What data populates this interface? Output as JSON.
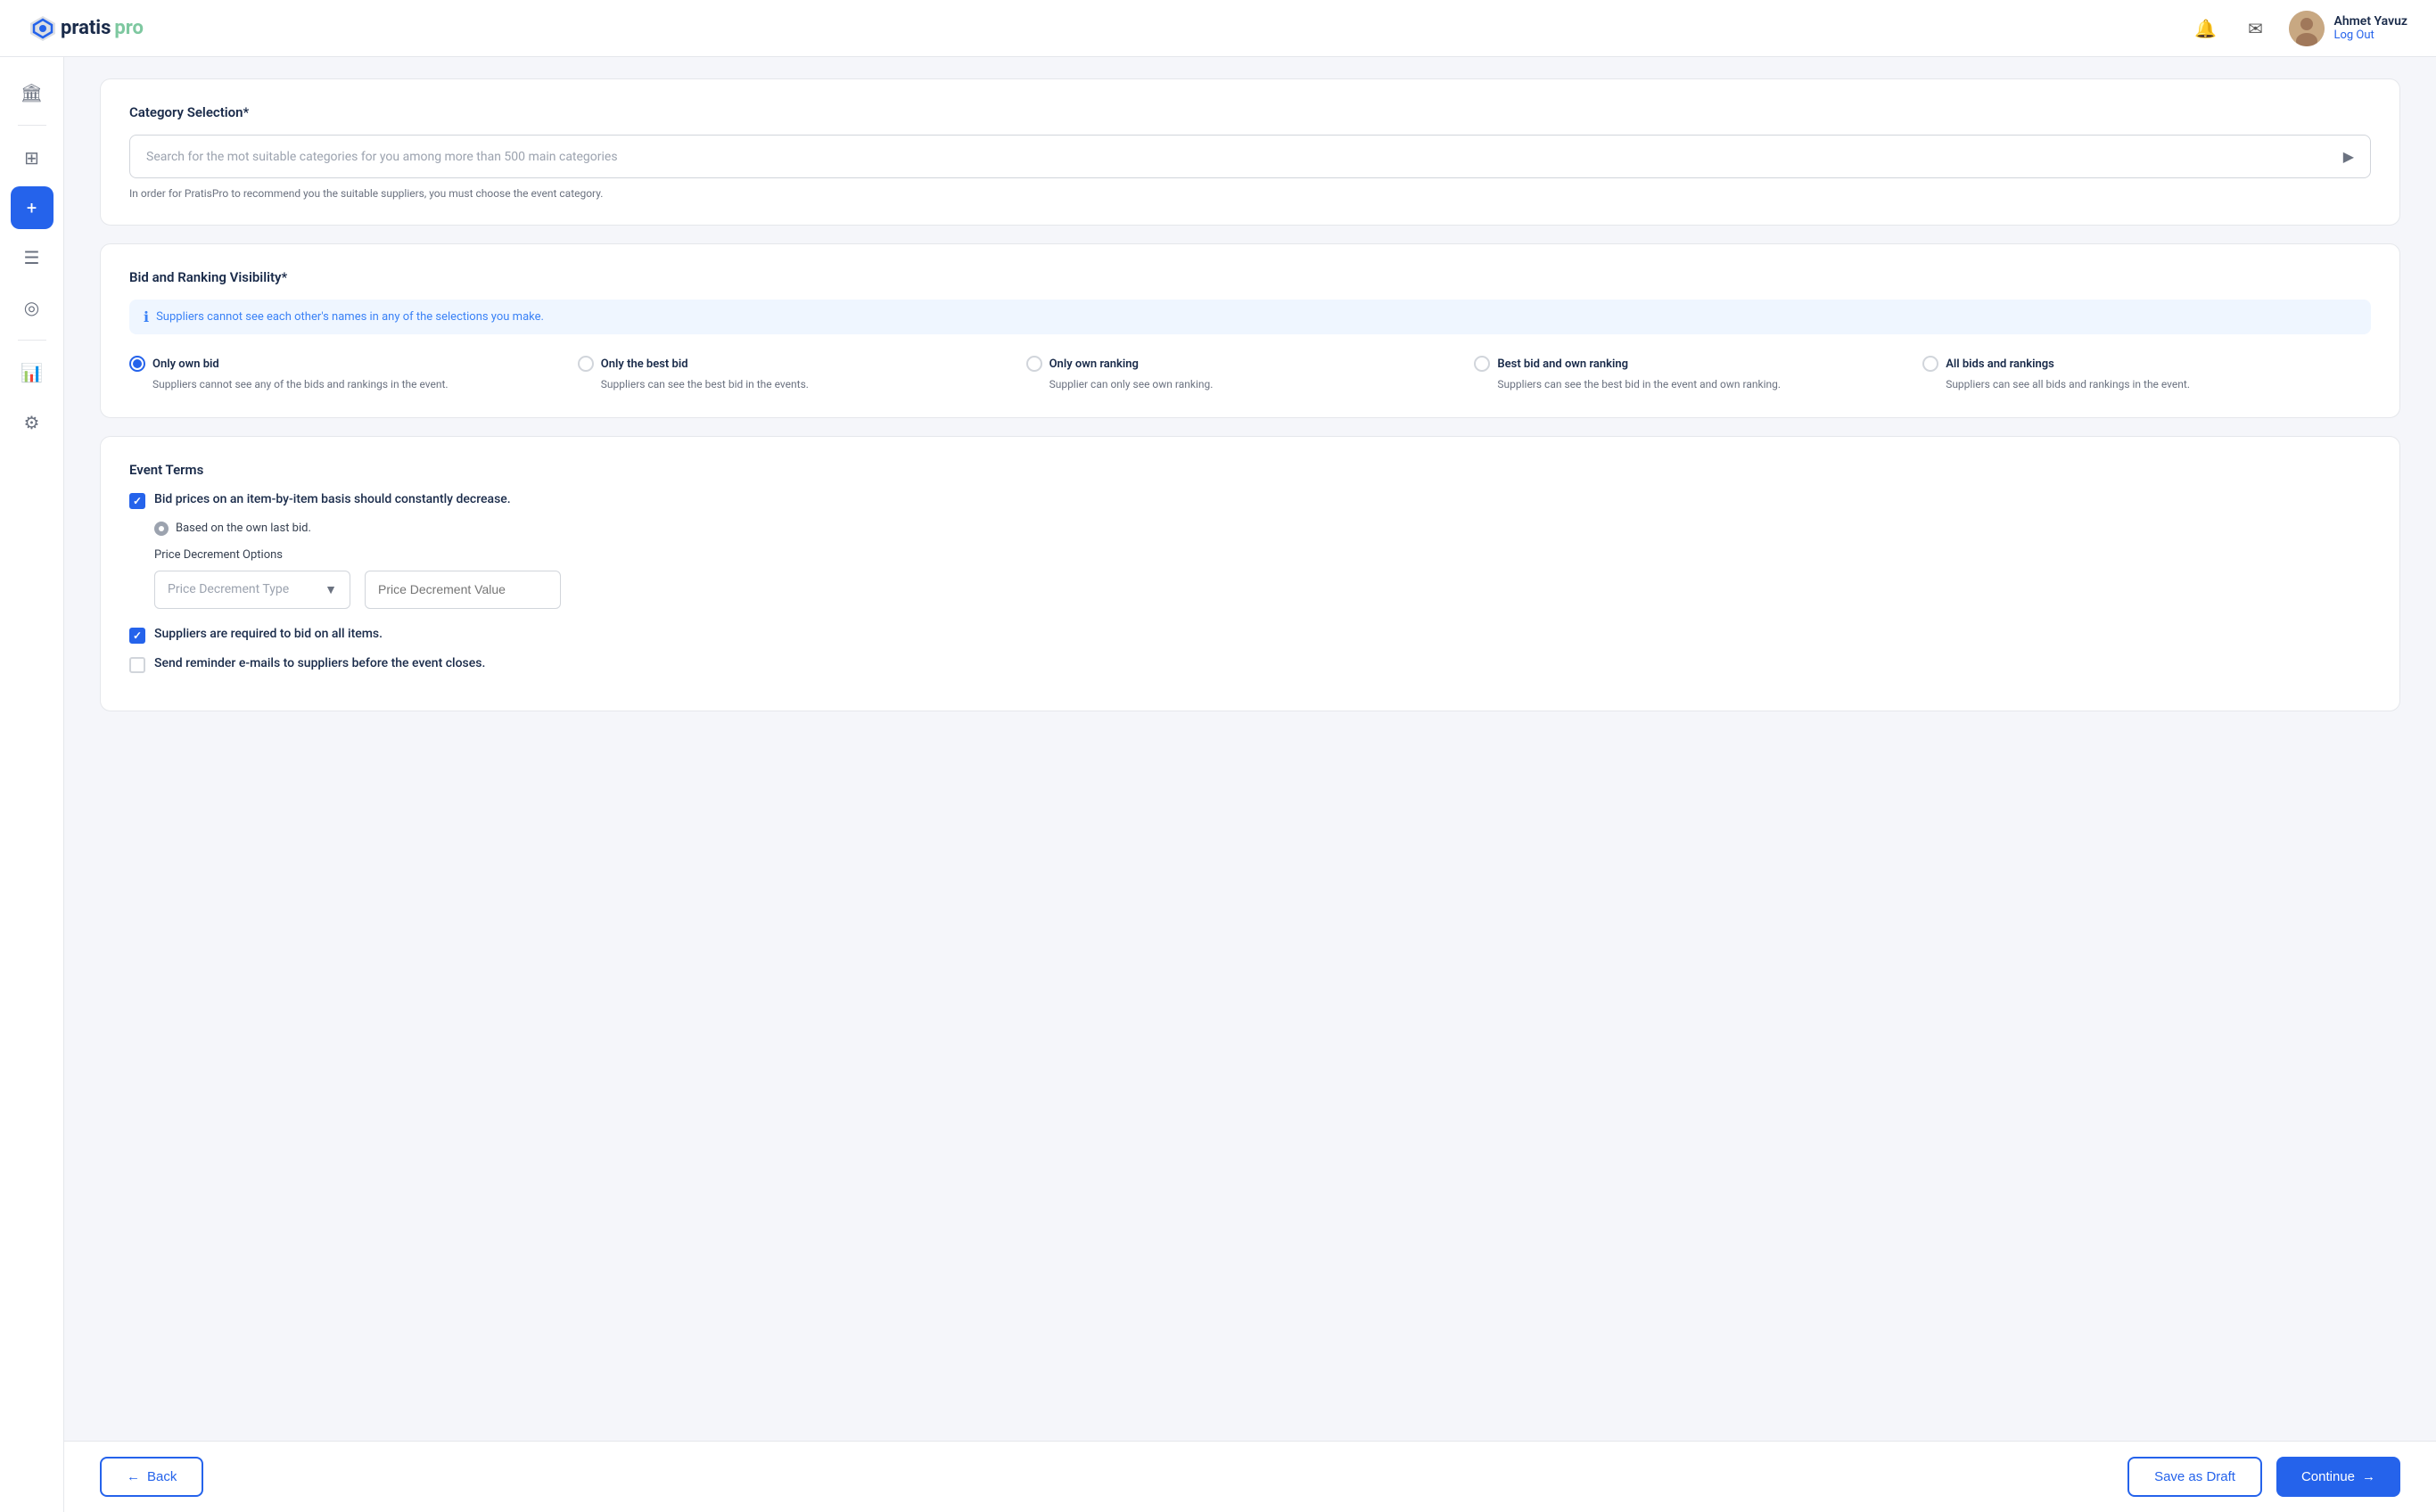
{
  "header": {
    "logo_text": "pratis",
    "logo_pro": "pro",
    "user_name": "Ahmet Yavuz",
    "logout_label": "Log Out"
  },
  "sidebar": {
    "items": [
      {
        "icon": "🏛",
        "label": "dashboard-icon",
        "active": false
      },
      {
        "icon": "⊞",
        "label": "grid-icon",
        "active": false
      },
      {
        "icon": "+",
        "label": "add-icon",
        "active": true
      },
      {
        "icon": "☰",
        "label": "list-icon",
        "active": false
      },
      {
        "icon": "◎",
        "label": "cube-icon",
        "active": false
      },
      {
        "icon": "📊",
        "label": "chart-icon",
        "active": false
      },
      {
        "icon": "⚙",
        "label": "settings-icon",
        "active": false
      }
    ]
  },
  "category_section": {
    "title": "Category Selection*",
    "search_placeholder": "Search for the mot suitable categories for you among more than 500 main categories",
    "hint": "In order for PratisPro to recommend you the suitable suppliers, you must choose the event category."
  },
  "bid_visibility": {
    "title": "Bid and Ranking Visibility*",
    "info_text": "Suppliers cannot see each other's names in any of the selections you make.",
    "options": [
      {
        "id": "only_own_bid",
        "label": "Only own bid",
        "description": "Suppliers cannot see any of the bids and rankings in the event.",
        "selected": true
      },
      {
        "id": "only_best_bid",
        "label": "Only the best bid",
        "description": "Suppliers can see the best bid in the events.",
        "selected": false
      },
      {
        "id": "only_own_ranking",
        "label": "Only own ranking",
        "description": "Supplier can only see own ranking.",
        "selected": false
      },
      {
        "id": "best_bid_own_ranking",
        "label": "Best bid and own ranking",
        "description": "Suppliers can see the best bid in the event and own ranking.",
        "selected": false
      },
      {
        "id": "all_bids_rankings",
        "label": "All bids and rankings",
        "description": "Suppliers can see all bids and rankings in the event.",
        "selected": false
      }
    ]
  },
  "event_terms": {
    "title": "Event Terms",
    "term1": {
      "label": "Bid prices on an item-by-item basis should constantly decrease.",
      "checked": true
    },
    "sub_radio_label": "Based on the own last bid.",
    "price_decrement": {
      "label": "Price Decrement Options",
      "type_placeholder": "Price Decrement Type",
      "value_placeholder": "Price Decrement Value"
    },
    "term2": {
      "label": "Suppliers are required to bid on all items.",
      "checked": true
    },
    "term3": {
      "label": "Send reminder e-mails to suppliers before the event closes.",
      "checked": false
    }
  },
  "footer": {
    "back_label": "Back",
    "draft_label": "Save as Draft",
    "continue_label": "Continue"
  }
}
